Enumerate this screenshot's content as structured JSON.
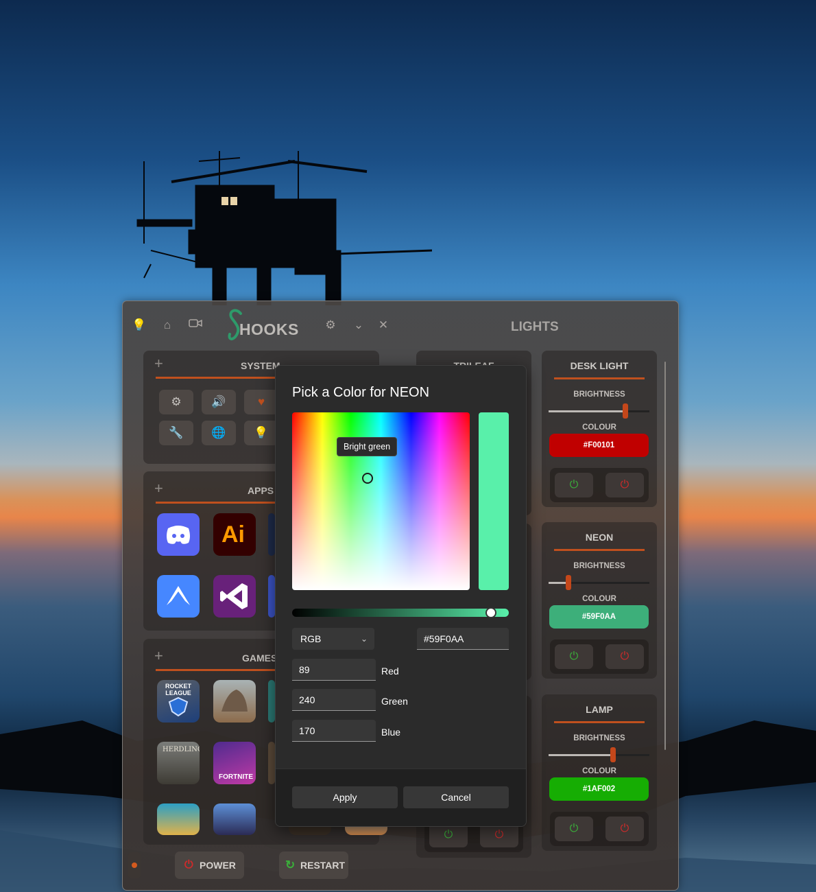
{
  "titlebar": {
    "brand": "HOOKS",
    "section_title": "LIGHTS"
  },
  "cards": {
    "system": "SYSTEM",
    "apps": "APPS",
    "games": "GAMES",
    "partial": "TRILEAF"
  },
  "app_tiles": {
    "adobe": "Ai"
  },
  "game_tiles": {
    "rocket_league": "ROCKET LEAGUE",
    "fortnite": "FORTNITE"
  },
  "lights": [
    {
      "name": "DESK LIGHT",
      "brightness_label": "BRIGHTNESS",
      "brightness": 0.76,
      "colour_label": "COLOUR",
      "colour": "#F00101",
      "colour_hex": "#c00000"
    },
    {
      "name": "NEON",
      "brightness_label": "BRIGHTNESS",
      "brightness": 0.2,
      "colour_label": "COLOUR",
      "colour": "#59F0AA",
      "colour_hex": "#3daf7a"
    },
    {
      "name": "LAMP",
      "brightness_label": "BRIGHTNESS",
      "brightness": 0.64,
      "colour_label": "COLOUR",
      "colour": "#1AF002",
      "colour_hex": "#16ad03"
    }
  ],
  "bottom": {
    "power": "POWER",
    "restart": "RESTART"
  },
  "dialog": {
    "title": "Pick a Color for NEON",
    "tooltip": "Bright green",
    "preview_color": "#59F0AA",
    "mode": "RGB",
    "hex_value": "#59F0AA",
    "red": "89",
    "red_label": "Red",
    "green": "240",
    "green_label": "Green",
    "blue": "170",
    "blue_label": "Blue",
    "apply": "Apply",
    "cancel": "Cancel"
  },
  "colors": {
    "accent": "#c0501e",
    "power_on": "#3ab03a",
    "power_off": "#d02a2a"
  }
}
